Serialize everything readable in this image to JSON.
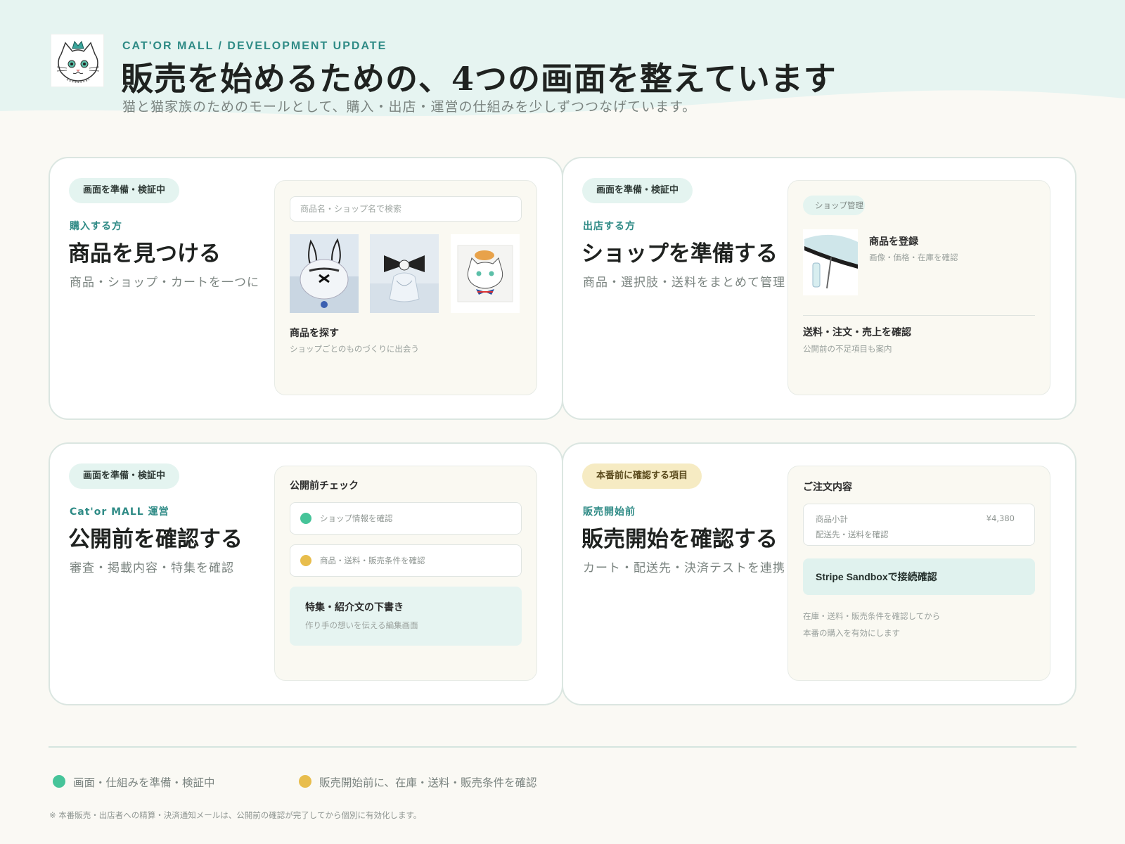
{
  "header": {
    "eyebrow": "CAT'OR MALL / DEVELOPMENT UPDATE",
    "title": "販売を始めるための、4つの画面を整えています",
    "subtitle": "猫と猫家族のためのモールとして、購入・出店・運営の仕組みを少しずつつなげています。",
    "logo_icon": "cat-with-crown-icon"
  },
  "colors": {
    "accent": "#2f8b86",
    "mint": "#e4f4f0",
    "status_green": "#46c499",
    "status_yellow": "#e8bd4c",
    "badge_yellow": "#f6ebc3"
  },
  "cards": [
    {
      "badge": "画面を準備・検証中",
      "role": "購入する方",
      "title": "商品を見つける",
      "desc": "商品・ショップ・カートを一つに",
      "panel": {
        "search_placeholder": "商品名・ショップ名で検索",
        "heading": "商品を探す",
        "sub": "ショップごとのものづくりに出会う",
        "thumbs": [
          "bunny-ear-hat-image",
          "ribbon-collar-image",
          "cat-illustration-image"
        ]
      }
    },
    {
      "badge": "画面を準備・検証中",
      "role": "出店する方",
      "title": "ショップを準備する",
      "desc": "商品・選択肢・送料をまとめて管理",
      "panel": {
        "chip": "ショップ管理",
        "item_title": "商品を登録",
        "item_sub": "画像・価格・在庫を確認",
        "heading": "送料・注文・売上を確認",
        "sub": "公開前の不足項目も案内",
        "image": "umbrella-image"
      }
    },
    {
      "badge": "画面を準備・検証中",
      "role": "Cat'or MALL 運営",
      "title": "公開前を確認する",
      "desc": "審査・掲載内容・特集を確認",
      "panel": {
        "heading": "公開前チェック",
        "checks": [
          "ショップ情報を確認",
          "商品・送料・販売条件を確認"
        ],
        "box_title": "特集・紹介文の下書き",
        "box_sub": "作り手の想いを伝える編集画面"
      }
    },
    {
      "badge": "本番前に確認する項目",
      "role": "販売開始前",
      "title": "販売開始を確認する",
      "desc": "カート・配送先・決済テストを連携",
      "panel": {
        "heading": "ご注文内容",
        "subtotal_label": "商品小計",
        "subtotal_value": "¥4,380",
        "shipping_label": "配送先・送料を確認",
        "button": "Stripe Sandboxで接続確認",
        "note1": "在庫・送料・販売条件を確認してから",
        "note2": "本番の購入を有効にします"
      }
    }
  ],
  "legend": [
    {
      "label": "画面・仕組みを準備・検証中",
      "color": "green"
    },
    {
      "label": "販売開始前に、在庫・送料・販売条件を確認",
      "color": "yellow"
    }
  ],
  "footnote": "※ 本番販売・出店者への精算・決済通知メールは、公開前の確認が完了してから個別に有効化します。"
}
